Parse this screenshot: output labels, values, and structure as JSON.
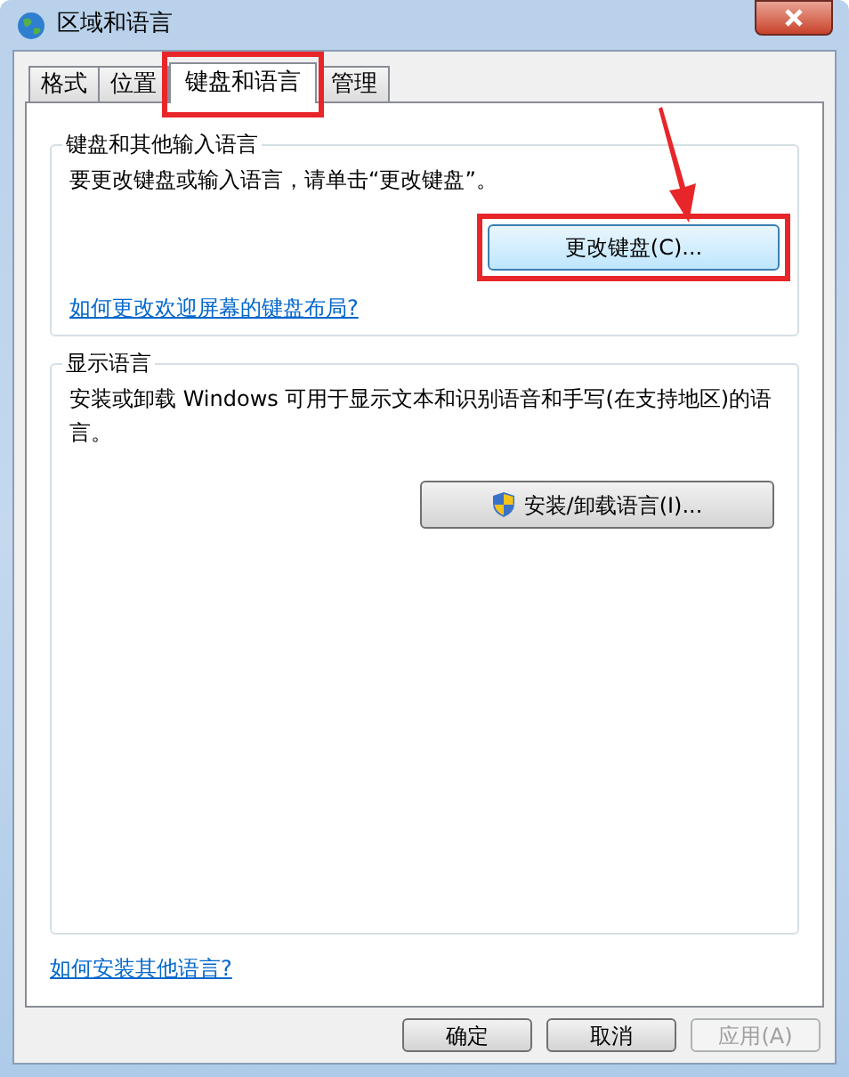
{
  "window": {
    "title": "区域和语言"
  },
  "tabs": [
    {
      "label": "格式",
      "selected": false,
      "highlighted": false
    },
    {
      "label": "位置",
      "selected": false,
      "highlighted": false
    },
    {
      "label": "键盘和语言",
      "selected": true,
      "highlighted": true
    },
    {
      "label": "管理",
      "selected": false,
      "highlighted": false
    }
  ],
  "keyboard_group": {
    "title": "键盘和其他输入语言",
    "description": "要更改键盘或输入语言，请单击“更改键盘”。",
    "button": {
      "label": "更改键盘(C)...",
      "highlighted": true
    },
    "link": "如何更改欢迎屏幕的键盘布局?"
  },
  "display_group": {
    "title": "显示语言",
    "description": "安装或卸载 Windows 可用于显示文本和识别语音和手写(在支持地区)的语言。",
    "button": {
      "label": "安装/卸载语言(I)...",
      "highlighted": false
    }
  },
  "link": "如何安装其他语言?",
  "buttons": [
    {
      "label": "确定",
      "disabled": false
    },
    {
      "label": "取消",
      "disabled": false
    },
    {
      "label": "应用(A)",
      "disabled": true
    }
  ]
}
